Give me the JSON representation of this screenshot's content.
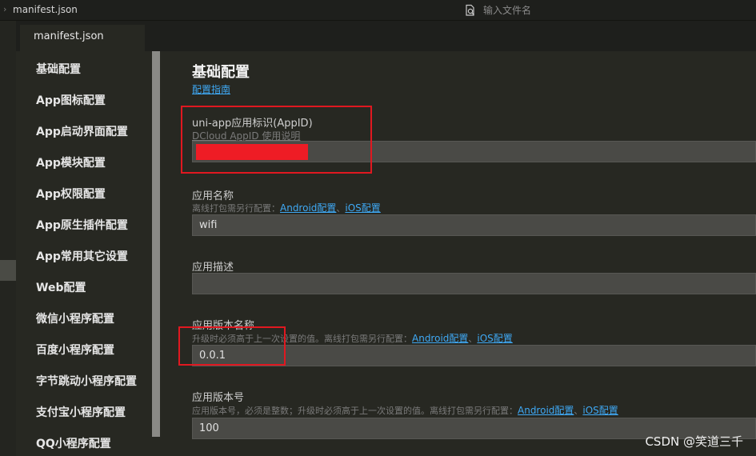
{
  "header": {
    "breadcrumb": "manifest.json",
    "search_placeholder": "输入文件名"
  },
  "tabs": [
    {
      "label": "manifest.json"
    }
  ],
  "sidebar": {
    "items": [
      "基础配置",
      "App图标配置",
      "App启动界面配置",
      "App模块配置",
      "App权限配置",
      "App原生插件配置",
      "App常用其它设置",
      "Web配置",
      "微信小程序配置",
      "百度小程序配置",
      "字节跳动小程序配置",
      "支付宝小程序配置",
      "QQ小程序配置"
    ]
  },
  "main": {
    "title": "基础配置",
    "guide_link": "配置指南",
    "appid": {
      "label": "uni-app应用标识(AppID)",
      "help_link": "DCloud AppID 使用说明",
      "value": ""
    },
    "app_name": {
      "label": "应用名称",
      "hint": "离线打包需另行配置：",
      "android_link": "Android配置",
      "sep": "、",
      "ios_link": "iOS配置",
      "value": "wifi"
    },
    "app_desc": {
      "label": "应用描述",
      "value": ""
    },
    "version_name": {
      "label": "应用版本名称",
      "hint": "升级时必须高于上一次设置的值。离线打包需另行配置：",
      "android_link": "Android配置",
      "sep": "、",
      "ios_link": "iOS配置",
      "value": "0.0.1"
    },
    "version_code": {
      "label": "应用版本号",
      "hint": "应用版本号，必须是整数；升级时必须高于上一次设置的值。离线打包需另行配置：",
      "android_link": "Android配置",
      "sep": "、",
      "ios_link": "iOS配置",
      "value": "100"
    }
  },
  "watermark": "CSDN @笑道三千",
  "colors": {
    "background": "#272822",
    "accent_link": "#3fa9f5",
    "annotation_red": "#e01820",
    "redaction_red": "#ee1c25"
  }
}
